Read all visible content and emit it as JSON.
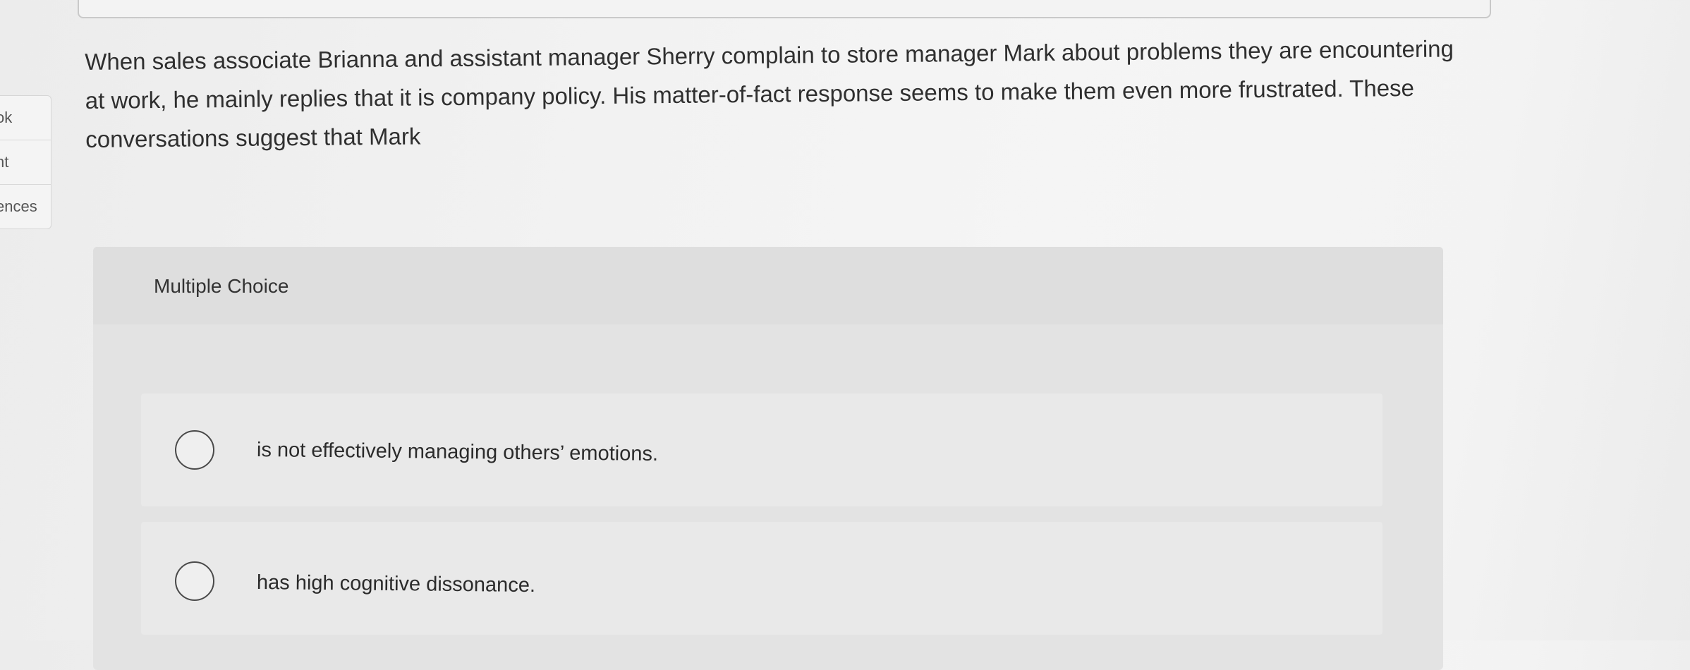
{
  "left_nav": {
    "items": [
      {
        "label": "ok"
      },
      {
        "label": "nt"
      },
      {
        "label": "ences"
      }
    ]
  },
  "question": {
    "text": "When sales associate Brianna and assistant manager Sherry complain to store manager Mark about problems they are encountering at work, he mainly replies that it is company policy. His matter-of-fact response seems to make them even more frustrated. These conversations suggest that Mark"
  },
  "multiple_choice": {
    "label": "Multiple Choice",
    "options": [
      {
        "text": "is not effectively managing others’ emotions."
      },
      {
        "text": "has high cognitive dissonance."
      }
    ]
  }
}
